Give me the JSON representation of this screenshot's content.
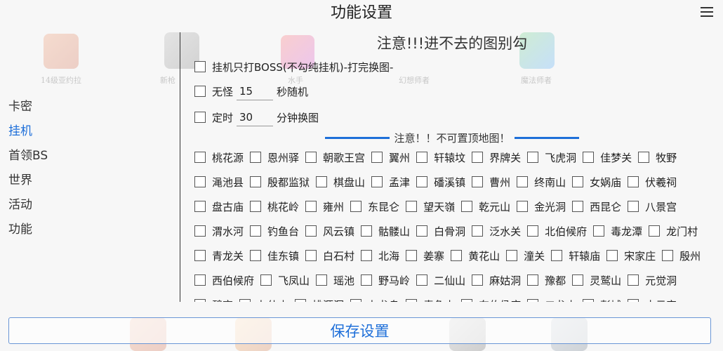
{
  "header": {
    "title": "功能设置"
  },
  "bg_labels": [
    "14级亚约拉",
    "新枪",
    "水手",
    "幻想师者",
    "魔法师者"
  ],
  "sidebar": {
    "items": [
      {
        "label": "卡密"
      },
      {
        "label": "挂机"
      },
      {
        "label": "首领BS"
      },
      {
        "label": "世界"
      },
      {
        "label": "活动"
      },
      {
        "label": "功能"
      }
    ],
    "active_index": 1
  },
  "content": {
    "note": "注意!!!进不去的图别勾",
    "boss_only": "挂机只打BOSS(不勾纯挂机)-打完换图-",
    "no_monster_prefix": "无怪",
    "no_monster_value": "15",
    "no_monster_suffix": "秒随机",
    "timer_prefix": "定时",
    "timer_value": "30",
    "timer_suffix": "分钟换图",
    "warning": "注意！！不可置顶地图！",
    "map_rows": [
      [
        "桃花源",
        "恩州驿",
        "朝歌王宫",
        "翼州",
        "轩辕坟",
        "界牌关",
        "飞虎洞",
        "佳梦关",
        "牧野"
      ],
      [
        "渑池县",
        "殷都监狱",
        "棋盘山",
        "孟津",
        "磻溪镇",
        "曹州",
        "终南山",
        "女娲庙",
        "伏羲祠"
      ],
      [
        "盘古庙",
        "桃花岭",
        "雍州",
        "东昆仑",
        "望天嶺",
        "乾元山",
        "金光洞",
        "西昆仑",
        "八景宫"
      ],
      [
        "渭水河",
        "钓鱼台",
        "风云镇",
        "骷髅山",
        "白骨洞",
        "泛水关",
        "北伯候府",
        "毒龙潭",
        "龙门村"
      ],
      [
        "青龙关",
        "佳东镇",
        "白石村",
        "北海",
        "姜寨",
        "黄花山",
        "潼关",
        "轩辕庙",
        "宋家庄",
        "殷州"
      ],
      [
        "西伯候府",
        "飞凤山",
        "瑶池",
        "野马岭",
        "二仙山",
        "麻姑洞",
        "豫都",
        "灵鹫山",
        "元觉洞"
      ],
      [
        "碧穹",
        "九仙山",
        "桃源洞",
        "九龙岛",
        "青龟山",
        "东伯侯府",
        "二龙山",
        "彭城",
        "水云宫"
      ]
    ]
  },
  "footer": {
    "save_label": "保存设置"
  },
  "colors": {
    "accent": "#1e6fd9",
    "text": "#222222",
    "background": "#f7f7f7"
  }
}
